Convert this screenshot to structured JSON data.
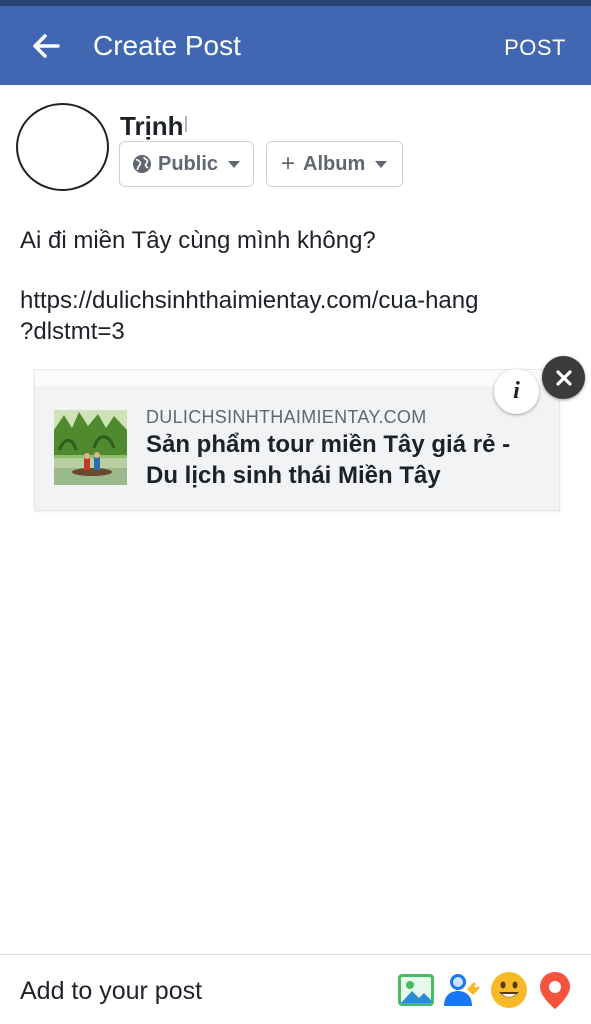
{
  "appbar": {
    "title": "Create Post",
    "back_icon": "back-arrow-icon",
    "post_label": "POST",
    "color": "#4267b2"
  },
  "composer": {
    "user_name": "Trịnh",
    "privacy_label": "Public",
    "privacy_icon": "globe-icon",
    "album_label": "Album",
    "album_icon": "plus-icon"
  },
  "post": {
    "line1": "Ai đi miền Tây cùng mình không?",
    "url_line1": "https://dulichsinhthaimientay.com/cua-hang",
    "url_line2": "?dlstmt=3"
  },
  "link_preview": {
    "domain": "DULICHSINHTHAIMIENTAY.COM",
    "title_line1": "Sản phẩm tour miền Tây giá rẻ -",
    "title_line2": "Du lịch sinh thái Miền Tây",
    "info_icon": "info-icon",
    "info_glyph": "i",
    "close_icon": "close-icon"
  },
  "footer": {
    "add_label": "Add to your post",
    "tools": [
      "photo-icon",
      "tag-people-icon",
      "feeling-icon",
      "checkin-icon"
    ]
  }
}
